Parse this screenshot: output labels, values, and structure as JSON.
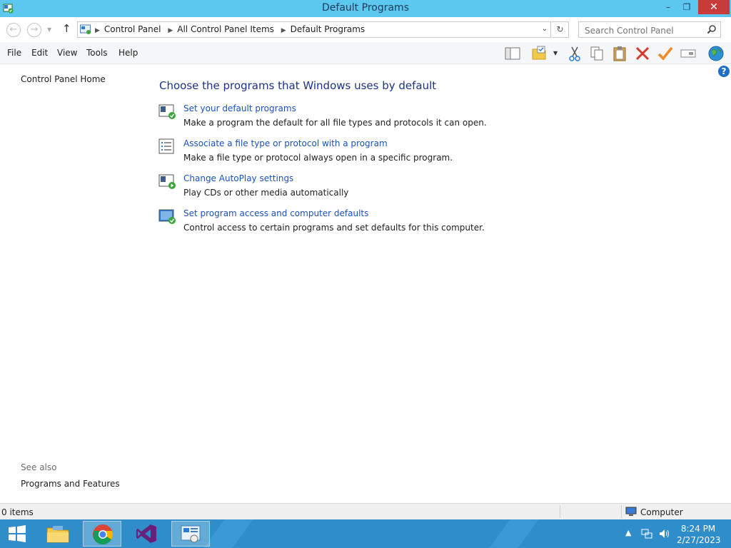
{
  "window": {
    "title": "Default Programs",
    "minimize": "–",
    "restore": "❐",
    "close": "✕"
  },
  "address": {
    "breadcrumbs": [
      "Control Panel",
      "All Control Panel Items",
      "Default Programs"
    ],
    "search_placeholder": "Search Control Panel"
  },
  "menu": {
    "items": [
      "File",
      "Edit",
      "View",
      "Tools",
      "Help"
    ]
  },
  "toolbar": {
    "icons": [
      "layout-pane-icon",
      "folder-options-icon",
      "cut-icon",
      "copy-icon",
      "paste-icon",
      "delete-icon",
      "properties-check-icon",
      "rename-icon",
      "globe-icon"
    ]
  },
  "sidebar": {
    "home": "Control Panel Home",
    "see_also": "See also",
    "programs_features": "Programs and Features"
  },
  "main": {
    "heading": "Choose the programs that Windows uses by default",
    "tasks": [
      {
        "link": "Set your default programs",
        "desc": "Make a program the default for all file types and protocols it can open."
      },
      {
        "link": "Associate a file type or protocol with a program",
        "desc": "Make a file type or protocol always open in a specific program."
      },
      {
        "link": "Change AutoPlay settings",
        "desc": "Play CDs or other media automatically"
      },
      {
        "link": "Set program access and computer defaults",
        "desc": "Control access to certain programs and set defaults for this computer."
      }
    ]
  },
  "status": {
    "items": "0 items",
    "location": "Computer"
  },
  "taskbar": {
    "time": "8:24 PM",
    "date": "2/27/2023",
    "pinned": [
      "start",
      "file-explorer",
      "chrome",
      "visual-studio",
      "control-panel"
    ]
  },
  "colors": {
    "titlebar": "#5cc8f0",
    "close": "#c73b3b",
    "link": "#1a52b9",
    "heading": "#1e3287",
    "taskbar": "#2f8ec9"
  }
}
